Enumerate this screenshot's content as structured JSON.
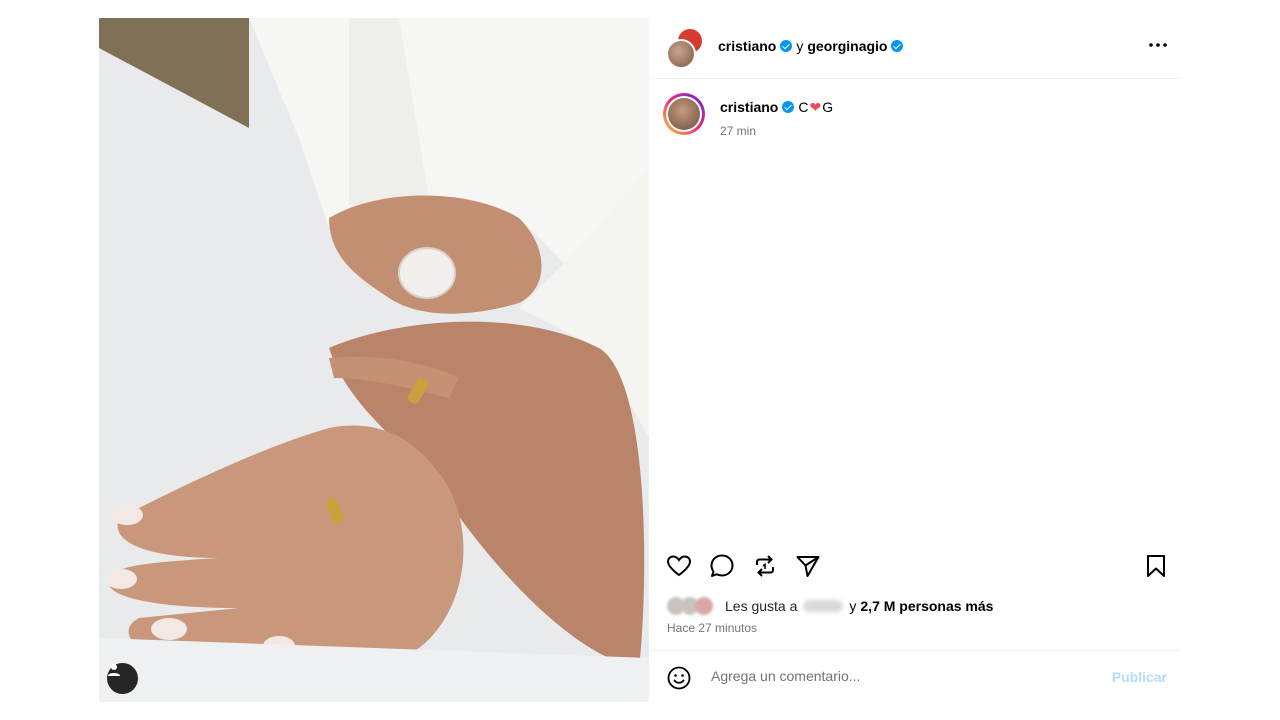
{
  "header": {
    "user1": "cristiano",
    "connector": "y",
    "user2": "georginagio",
    "more_icon": "more-horizontal-icon"
  },
  "caption": {
    "username": "cristiano",
    "text_c": "C",
    "heart": "❤",
    "text_g": "G",
    "time": "27 min"
  },
  "actions": {
    "icons": [
      "heart-icon",
      "comment-icon",
      "repost-icon",
      "share-icon",
      "bookmark-icon"
    ]
  },
  "likes": {
    "prefix": "Les gusta a",
    "connector": "y",
    "count": "2,7 M personas más"
  },
  "posted_ago": "Hace 27 minutos",
  "comment": {
    "placeholder": "Agrega un comentario...",
    "publish": "Publicar"
  },
  "colors": {
    "verified": "#0095f6",
    "publish_disabled": "#b3dbff",
    "heart": "#ed4956"
  }
}
